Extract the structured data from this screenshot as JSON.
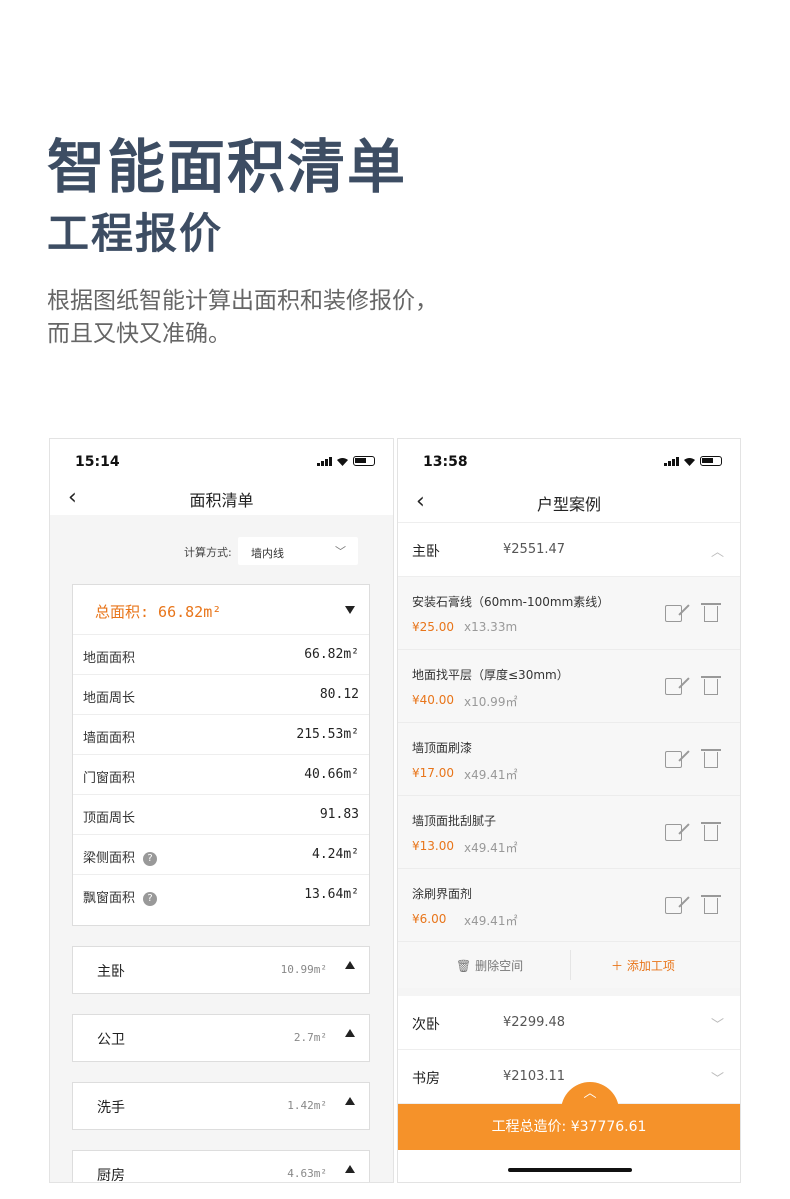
{
  "hero": {
    "title": "智能面积清单",
    "subtitle": "工程报价",
    "desc_line1": "根据图纸智能计算出面积和装修报价，",
    "desc_line2": "而且又快又准确。"
  },
  "phone1": {
    "time": "15:14",
    "nav_title": "面积清单",
    "calc_label": "计算方式:",
    "calc_value": "墙内线",
    "total": "总面积: 66.82m²",
    "metrics": [
      {
        "k": "地面面积",
        "v": "66.82m²"
      },
      {
        "k": "地面周长",
        "v": "80.12"
      },
      {
        "k": "墙面面积",
        "v": "215.53m²"
      },
      {
        "k": "门窗面积",
        "v": "40.66m²"
      },
      {
        "k": "顶面周长",
        "v": "91.83"
      },
      {
        "k": "梁侧面积",
        "v": "4.24m²"
      },
      {
        "k": "飘窗面积",
        "v": "13.64m²"
      }
    ],
    "rooms": [
      {
        "n": "主卧",
        "a": "10.99m²"
      },
      {
        "n": "公卫",
        "a": "2.7m²"
      },
      {
        "n": "洗手",
        "a": "1.42m²"
      },
      {
        "n": "厨房",
        "a": "4.63m²"
      }
    ]
  },
  "phone2": {
    "time": "13:58",
    "nav_title": "户型案例",
    "sections": [
      {
        "n": "主卧",
        "p": "¥2551.47"
      },
      {
        "n": "次卧",
        "p": "¥2299.48"
      },
      {
        "n": "书房",
        "p": "¥2103.11"
      }
    ],
    "items": [
      {
        "t": "安装石膏线（60mm-100mm素线）",
        "pr": "¥25.00",
        "q": "x13.33m"
      },
      {
        "t": "地面找平层（厚度≤30mm）",
        "pr": "¥40.00",
        "q": "x10.99㎡"
      },
      {
        "t": "墙顶面刷漆",
        "pr": "¥17.00",
        "q": "x49.41㎡"
      },
      {
        "t": "墙顶面批刮腻子",
        "pr": "¥13.00",
        "q": "x49.41㎡"
      },
      {
        "t": "涂刷界面剂",
        "pr": "¥6.00",
        "q": "x49.41㎡"
      }
    ],
    "delete_space": "删除空间",
    "add_item": "添加工项",
    "total_label": "工程总造价: ¥37776.61"
  }
}
